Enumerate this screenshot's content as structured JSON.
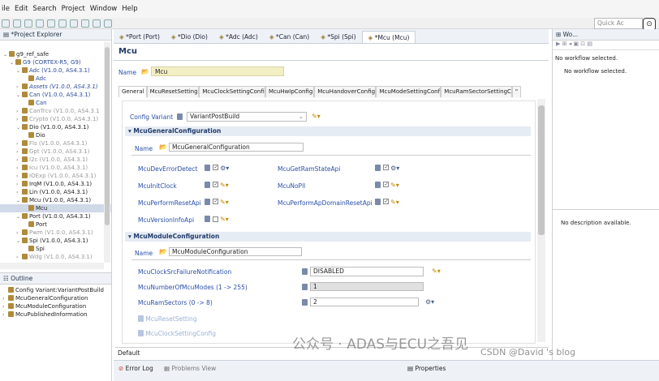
{
  "menubar": {
    "items": [
      "ile",
      "Edit",
      "Search",
      "Project",
      "Window",
      "Help"
    ]
  },
  "quick_access": "Quick Ac",
  "project_explorer": {
    "title": "*Project Explorer",
    "tree": [
      {
        "text": "g9_ref_safe",
        "indent": 0,
        "tri": "v",
        "style": ""
      },
      {
        "text": "G9 (CORTEX-R5, G9)",
        "indent": 1,
        "tri": "v",
        "style": "blue"
      },
      {
        "text": "Adc (V1.0.0, AS4.3.1)",
        "indent": 2,
        "tri": "v",
        "style": "blue"
      },
      {
        "text": "Adc",
        "indent": 3,
        "tri": "",
        "style": "blue"
      },
      {
        "text": "Assets (V1.0.0, AS4.3.1)",
        "indent": 2,
        "tri": ">",
        "style": "italic"
      },
      {
        "text": "Can (V1.0.0, AS4.3.1)",
        "indent": 2,
        "tri": "v",
        "style": "blue"
      },
      {
        "text": "Can",
        "indent": 3,
        "tri": "",
        "style": "blue"
      },
      {
        "text": "CanTrcv (V1.0.0, AS4.3.1",
        "indent": 2,
        "tri": ">",
        "style": "gray"
      },
      {
        "text": "Crypto (V1.0.0, AS4.3.1)",
        "indent": 2,
        "tri": ">",
        "style": "gray"
      },
      {
        "text": "Dio (V1.0.0, AS4.3.1)",
        "indent": 2,
        "tri": "v",
        "style": ""
      },
      {
        "text": "Dio",
        "indent": 3,
        "tri": "",
        "style": ""
      },
      {
        "text": "Fls (V1.0.0, AS4.3.1)",
        "indent": 2,
        "tri": ">",
        "style": "gray"
      },
      {
        "text": "Gpt (V1.0.0, AS4.3.1)",
        "indent": 2,
        "tri": ">",
        "style": "gray"
      },
      {
        "text": "I2c (V1.0.0, AS4.3.1)",
        "indent": 2,
        "tri": ">",
        "style": "gray"
      },
      {
        "text": "Icu (V1.0.0, AS4.3.1)",
        "indent": 2,
        "tri": ">",
        "style": "gray"
      },
      {
        "text": "IOExp (V1.0.0, AS4.3.1)",
        "indent": 2,
        "tri": ">",
        "style": "gray"
      },
      {
        "text": "IrqM (V1.0.0, AS4.3.1)",
        "indent": 2,
        "tri": ">",
        "style": ""
      },
      {
        "text": "Lin (V1.0.0, AS4.3.1)",
        "indent": 2,
        "tri": ">",
        "style": ""
      },
      {
        "text": "Mcu (V1.0.0, AS4.3.1)",
        "indent": 2,
        "tri": "v",
        "style": ""
      },
      {
        "text": "Mcu",
        "indent": 3,
        "tri": "",
        "style": "sel"
      },
      {
        "text": "Port (V1.0.0, AS4.3.1)",
        "indent": 2,
        "tri": "v",
        "style": ""
      },
      {
        "text": "Port",
        "indent": 3,
        "tri": "",
        "style": ""
      },
      {
        "text": "Pwm (V1.0.0, AS4.3.1)",
        "indent": 2,
        "tri": ">",
        "style": "gray"
      },
      {
        "text": "Spi (V1.0.0, AS4.3.1)",
        "indent": 2,
        "tri": "v",
        "style": ""
      },
      {
        "text": "Spi",
        "indent": 3,
        "tri": "",
        "style": ""
      },
      {
        "text": "Wdg (V1.0.0, AS4.3.1)",
        "indent": 2,
        "tri": ">",
        "style": "gray"
      }
    ]
  },
  "outline": {
    "title": "Outline",
    "items": [
      {
        "text": "Config Variant:VariantPostBuild",
        "tri": ""
      },
      {
        "text": "McuGeneralConfiguration",
        "tri": ">"
      },
      {
        "text": "McuModuleConfiguration",
        "tri": ">"
      },
      {
        "text": "McuPublishedInformation",
        "tri": ">"
      }
    ]
  },
  "editor_tabs": [
    "*Port (Port)",
    "*Dio (Dio)",
    "*Adc (Adc)",
    "*Can (Can)",
    "*Spi (Spi)",
    "*Mcu (Mcu)"
  ],
  "editor": {
    "title": "Mcu",
    "name_label": "Name",
    "name_value": "Mcu",
    "subtabs": [
      "General",
      "McuResetSetting",
      "McuClockSettingConfi",
      "McuHwIpConfig",
      "McuHandoverConfig",
      "McuModeSettingConf",
      "McuRamSectorSettingC",
      "\""
    ],
    "config_variant_label": "Config Variant",
    "config_variant_value": "VariantPostBuild",
    "general_section": "McuGeneralConfiguration",
    "general_name_label": "Name",
    "general_name_value": "McuGeneralConfiguration",
    "params_left": [
      {
        "label": "McuDevErrorDetect",
        "checked": true,
        "icon": "gear"
      },
      {
        "label": "McuInitClock",
        "checked": true,
        "icon": "pen"
      },
      {
        "label": "McuPerformResetApi",
        "checked": true,
        "icon": "pen"
      },
      {
        "label": "McuVersionInfoApi",
        "checked": false,
        "icon": "pen"
      }
    ],
    "params_right": [
      {
        "label": "McuGetRamStateApi",
        "checked": true,
        "icon": "gear"
      },
      {
        "label": "McuNoPll",
        "checked": true,
        "icon": "pen"
      },
      {
        "label": "McuPerformApDomainResetApi",
        "checked": true,
        "icon": "pen"
      }
    ],
    "module_section": "McuModuleConfiguration",
    "module_name_label": "Name",
    "module_name_value": "McuModuleConfiguration",
    "module_params": [
      {
        "label": "McuClockSrcFailureNotification",
        "value": "DISABLED",
        "kind": "select"
      },
      {
        "label": "McuNumberOfMcuModes (1 -> 255)",
        "value": "1",
        "kind": "disabled"
      },
      {
        "label": "McuRamSectors (0 -> 8)",
        "value": "2",
        "kind": "input"
      }
    ],
    "links": [
      "McuResetSetting",
      "McuClockSettingConfig"
    ],
    "default_tab": "Default"
  },
  "right_top": {
    "title": "Wo...",
    "msg1": "No workflow selected.",
    "msg2": "No workflow selected."
  },
  "right_bottom": {
    "msg": "No description available."
  },
  "bottom_bar": {
    "error_log": "Error Log",
    "problems": "Problems View",
    "properties": "Properties"
  },
  "watermark": "公众号 · ADAS与ECU之吾见",
  "watermark2": "CSDN @David  's blog"
}
